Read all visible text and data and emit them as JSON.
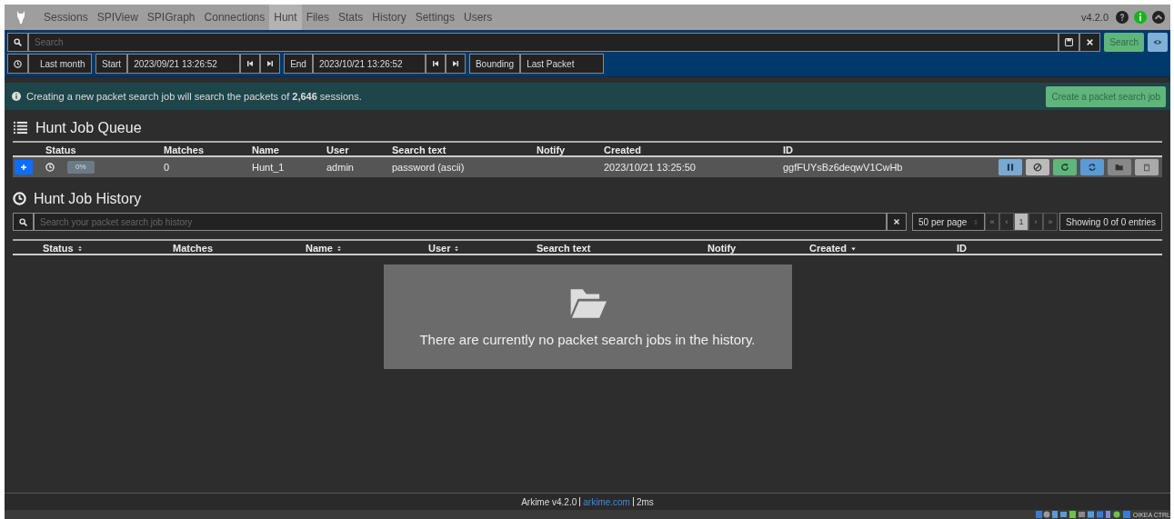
{
  "nav": {
    "items": [
      {
        "label": "Sessions",
        "selected": false
      },
      {
        "label": "SPIView",
        "selected": false
      },
      {
        "label": "SPIGraph",
        "selected": false
      },
      {
        "label": "Connections",
        "selected": false
      },
      {
        "label": "Hunt",
        "selected": true
      },
      {
        "label": "Files",
        "selected": false
      },
      {
        "label": "Stats",
        "selected": false
      },
      {
        "label": "History",
        "selected": false
      },
      {
        "label": "Settings",
        "selected": false
      },
      {
        "label": "Users",
        "selected": false
      }
    ],
    "version": "v4.2.0"
  },
  "search": {
    "placeholder": "Search",
    "button": "Search"
  },
  "time": {
    "range": "Last month",
    "start_label": "Start",
    "start": "2023/09/21 13:26:52",
    "end_label": "End",
    "end": "2023/10/21 13:26:52",
    "bounding_label": "Bounding",
    "bounding": "Last Packet"
  },
  "alert": {
    "text": "Creating a new packet search job will search the packets of **2,646** sessions.",
    "button": "Create a packet search job"
  },
  "queue": {
    "title": "Hunt Job Queue",
    "columns": [
      "Status",
      "Matches",
      "Name",
      "User",
      "Search text",
      "Notify",
      "Created",
      "ID"
    ],
    "rows": [
      {
        "progress": "0%",
        "matches": "0",
        "name": "Hunt_1",
        "user": "admin",
        "search_text": "password (ascii)",
        "created": "2023/10/21 13:25:50",
        "id": "ggfFUYsBz6deqwV1CwHb"
      }
    ],
    "actions": [
      {
        "kind": "pause"
      },
      {
        "kind": "cancel"
      },
      {
        "kind": "rerun"
      },
      {
        "kind": "repeat"
      },
      {
        "kind": "open"
      },
      {
        "kind": "delete"
      }
    ]
  },
  "history": {
    "title": "Hunt Job History",
    "search_placeholder": "Search your packet search job history",
    "per_page": "50 per page",
    "pages": [
      {
        "label": "«",
        "selected": false,
        "disabled": true
      },
      {
        "label": "‹",
        "selected": false,
        "disabled": true
      },
      {
        "label": "1",
        "selected": true,
        "disabled": false
      },
      {
        "label": "›",
        "selected": false,
        "disabled": true
      },
      {
        "label": "»",
        "selected": false,
        "disabled": true
      }
    ],
    "showing": "Showing 0 of 0 entries",
    "columns": [
      {
        "label": "Status",
        "sortable": true,
        "sort_descending": false
      },
      {
        "label": "Matches",
        "sortable": false,
        "sort_descending": false
      },
      {
        "label": "Name",
        "sortable": true,
        "sort_descending": false
      },
      {
        "label": "User",
        "sortable": true,
        "sort_descending": false
      },
      {
        "label": "Search text",
        "sortable": false,
        "sort_descending": false
      },
      {
        "label": "Notify",
        "sortable": false,
        "sort_descending": false
      },
      {
        "label": "Created",
        "sortable": true,
        "sort_descending": true
      },
      {
        "label": "ID",
        "sortable": false,
        "sort_descending": false
      }
    ],
    "empty_message": "There are currently no packet search jobs in the history."
  },
  "footer": {
    "product": "Arkime v4.2.0",
    "link": "arkime.com",
    "time": "2ms"
  },
  "host_bar": {
    "label": "OIKEA CTRL"
  }
}
